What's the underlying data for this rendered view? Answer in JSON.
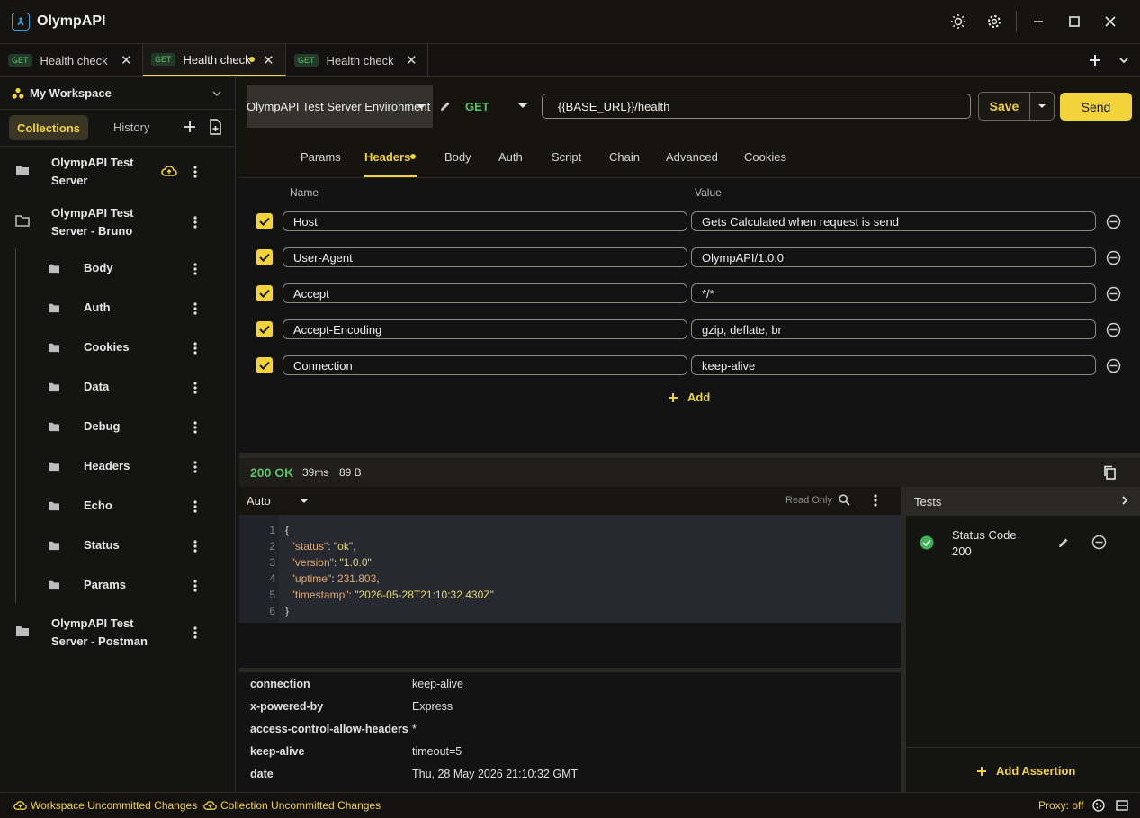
{
  "app": {
    "title": "OlympAPI"
  },
  "tabs": [
    {
      "method": "GET",
      "name": "Health check",
      "active": false,
      "dirty": false
    },
    {
      "method": "GET",
      "name": "Health check",
      "active": true,
      "dirty": true
    },
    {
      "method": "GET",
      "name": "Health check",
      "active": false,
      "dirty": false
    }
  ],
  "sidebar": {
    "workspace": "My Workspace",
    "tabs": {
      "collections": "Collections",
      "history": "History"
    },
    "collections": [
      {
        "label_line1": "OlympAPI Test",
        "label_line2": "Server"
      },
      {
        "label_line1": "OlympAPI Test",
        "label_line2": "Server - Bruno"
      },
      {
        "label_line1": "OlympAPI Test",
        "label_line2": "Server - Postman"
      }
    ],
    "folders": [
      "Body",
      "Auth",
      "Cookies",
      "Data",
      "Debug",
      "Headers",
      "Echo",
      "Status",
      "Params"
    ]
  },
  "request": {
    "environment": "OlympAPI Test Server Environment",
    "method": "GET",
    "url": "{{BASE_URL}}/health",
    "save_label": "Save",
    "send_label": "Send",
    "tabs": [
      "Params",
      "Headers",
      "Body",
      "Auth",
      "Script",
      "Chain",
      "Advanced",
      "Cookies"
    ],
    "active_tab": "Headers"
  },
  "headers": {
    "col_name": "Name",
    "col_value": "Value",
    "rows": [
      {
        "name": "Host",
        "value": "Gets Calculated when request is send",
        "enabled": true
      },
      {
        "name": "User-Agent",
        "value": "OlympAPI/1.0.0",
        "enabled": true
      },
      {
        "name": "Accept",
        "value": "*/*",
        "enabled": true
      },
      {
        "name": "Accept-Encoding",
        "value": "gzip, deflate, br",
        "enabled": true
      },
      {
        "name": "Connection",
        "value": "keep-alive",
        "enabled": true
      }
    ],
    "add_label": "Add"
  },
  "response": {
    "status": "200 OK",
    "time": "39ms",
    "size": "89 B",
    "format": "Auto",
    "readonly_label": "Read Only",
    "body_lines": [
      {
        "n": "1",
        "text": "{"
      },
      {
        "n": "2",
        "key": "\"status\"",
        "val": "\"ok\"",
        "kind": "s"
      },
      {
        "n": "3",
        "key": "\"version\"",
        "val": "\"1.0.0\"",
        "kind": "s"
      },
      {
        "n": "4",
        "key": "\"uptime\"",
        "val": "231.803",
        "kind": "n"
      },
      {
        "n": "5",
        "key": "\"timestamp\"",
        "val": "\"2026-05-28T21:10:32.430Z\"",
        "kind": "s"
      },
      {
        "n": "6",
        "text": "}"
      }
    ],
    "headers": [
      {
        "key": "connection",
        "value": "keep-alive"
      },
      {
        "key": "x-powered-by",
        "value": "Express"
      },
      {
        "key": "access-control-allow-headers",
        "value": "*"
      },
      {
        "key": "keep-alive",
        "value": "timeout=5"
      },
      {
        "key": "date",
        "value": "Thu, 28 May 2026 21:10:32 GMT"
      }
    ]
  },
  "tests": {
    "title": "Tests",
    "assertions": [
      {
        "line1": "Status Code",
        "line2": "200",
        "passed": true
      }
    ],
    "add_label": "Add Assertion"
  },
  "statusbar": {
    "workspace_changes": "Workspace Uncommitted Changes",
    "collection_changes": "Collection Uncommitted Changes",
    "proxy": "Proxy: off"
  },
  "colors": {
    "accent": "#f2d33a",
    "success": "#58c26a",
    "background": "#131313"
  }
}
